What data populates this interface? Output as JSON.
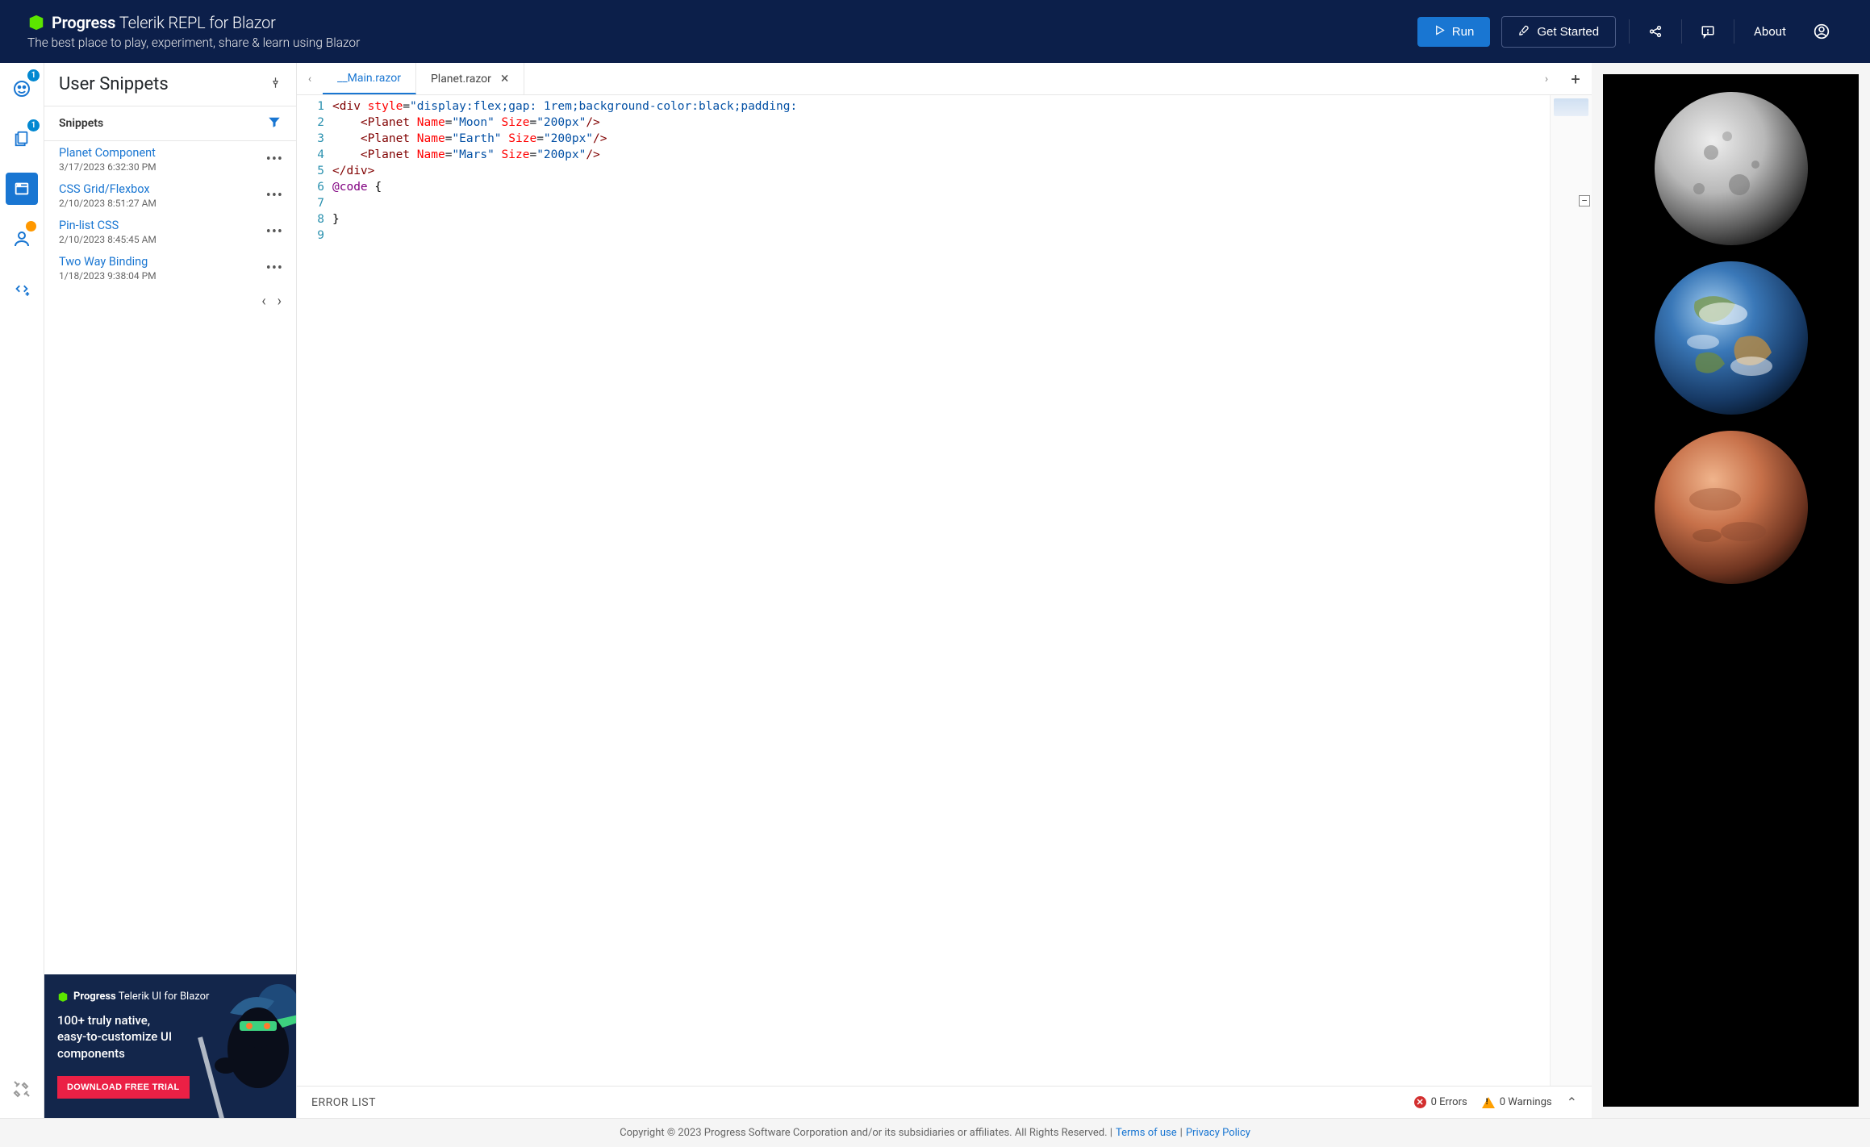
{
  "header": {
    "brand_prefix": "Progress",
    "brand_mid": "Telerik",
    "brand_suffix": "REPL for Blazor",
    "tagline": "The best place to play, experiment, share & learn using Blazor",
    "run_label": "Run",
    "get_started_label": "Get Started",
    "about_label": "About"
  },
  "rail": {
    "badge1": "1",
    "badge2": "1"
  },
  "sidebar": {
    "title": "User Snippets",
    "section_label": "Snippets",
    "items": [
      {
        "name": "Planet Component",
        "time": "3/17/2023 6:32:30 PM"
      },
      {
        "name": "CSS Grid/Flexbox",
        "time": "2/10/2023 8:51:27 AM"
      },
      {
        "name": "Pin-list CSS",
        "time": "2/10/2023 8:45:45 AM"
      },
      {
        "name": "Two Way Binding",
        "time": "1/18/2023 9:38:04 PM"
      }
    ]
  },
  "promo": {
    "brand_prefix": "Progress",
    "brand_mid": "Telerik",
    "brand_suffix": "UI for Blazor",
    "text": "100+ truly native, easy-to-customize UI components",
    "cta": "DOWNLOAD FREE TRIAL"
  },
  "tabs": {
    "active": "__Main.razor",
    "other": "Planet.razor"
  },
  "code": {
    "lines": [
      {
        "n": "1",
        "html": "<span class='tag'>&lt;div</span> <span class='attr'>style</span>=<span class='str'>\"display:flex;gap: 1rem;background-color:black;padding:</span>"
      },
      {
        "n": "2",
        "html": "    <span class='tag'>&lt;Planet</span> <span class='attr'>Name</span>=<span class='str'>\"Moon\"</span> <span class='attr'>Size</span>=<span class='str'>\"200px\"</span><span class='tag'>/&gt;</span>"
      },
      {
        "n": "3",
        "html": "    <span class='tag'>&lt;Planet</span> <span class='attr'>Name</span>=<span class='str'>\"Earth\"</span> <span class='attr'>Size</span>=<span class='str'>\"200px\"</span><span class='tag'>/&gt;</span>"
      },
      {
        "n": "4",
        "html": "    <span class='tag'>&lt;Planet</span> <span class='attr'>Name</span>=<span class='str'>\"Mars\"</span> <span class='attr'>Size</span>=<span class='str'>\"200px\"</span><span class='tag'>/&gt;</span>"
      },
      {
        "n": "5",
        "html": "<span class='tag'>&lt;/div&gt;</span>"
      },
      {
        "n": "6",
        "html": "<span class='razor'>@code</span> <span class='brace'>{</span>"
      },
      {
        "n": "7",
        "html": ""
      },
      {
        "n": "8",
        "html": "<span class='brace'>}</span>"
      },
      {
        "n": "9",
        "html": ""
      }
    ]
  },
  "error_bar": {
    "title": "ERROR LIST",
    "errors_count": "0 Errors",
    "warnings_count": "0 Warnings"
  },
  "footer": {
    "copyright": "Copyright © 2023 Progress Software Corporation and/or its subsidiaries or affiliates. All Rights Reserved. |",
    "terms": "Terms of use",
    "sep": "|",
    "privacy": "Privacy Policy"
  },
  "preview": {
    "planets": [
      "Moon",
      "Earth",
      "Mars"
    ]
  }
}
